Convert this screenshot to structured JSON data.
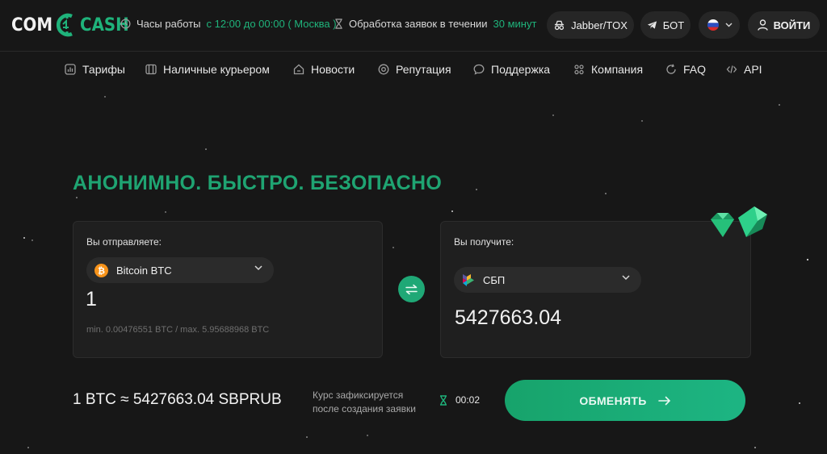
{
  "brand": {
    "logo_left": "COM",
    "logo_right": "CASH"
  },
  "header": {
    "hours_prefix": "Часы работы",
    "hours_value": "с 12:00 до 00:00 ( Москва )",
    "processing_prefix": "Обработка заявок в течении",
    "processing_value": "30 минут",
    "jabber_label": "Jabber/TOX",
    "bot_label": "БОТ",
    "login_label": "ВОЙТИ"
  },
  "nav": [
    {
      "label": "Тарифы",
      "icon": "chart-icon"
    },
    {
      "label": "Наличные курьером",
      "icon": "cash-icon"
    },
    {
      "label": "Новости",
      "icon": "home-icon"
    },
    {
      "label": "Репутация",
      "icon": "star-icon"
    },
    {
      "label": "Поддержка",
      "icon": "chat-icon"
    },
    {
      "label": "Компания",
      "icon": "people-icon"
    },
    {
      "label": "FAQ",
      "icon": "refresh-icon"
    },
    {
      "label": "API",
      "icon": "code-icon"
    }
  ],
  "hero": {
    "headline": "АНОНИМНО. БЫСТРО. БЕЗОПАСНО"
  },
  "send": {
    "label": "Вы отправляете:",
    "currency": "Bitcoin BTC",
    "amount": "1",
    "limits": "min. 0.00476551 BTC / max. 5.95688968 BTC"
  },
  "receive": {
    "label": "Вы получите:",
    "currency": "СБП",
    "amount": "5427663.04"
  },
  "footer": {
    "rate": "1 BTC ≈ 5427663.04 SBPRUB",
    "fixed_line1": "Курс зафиксируется",
    "fixed_line2": "после создания заявки",
    "timer": "00:02",
    "exchange_label": "ОБМЕНЯТЬ"
  },
  "colors": {
    "accent": "#1fb37b",
    "bitcoin": "#f7931a",
    "background": "#171717",
    "card": "#1f1f1f"
  }
}
